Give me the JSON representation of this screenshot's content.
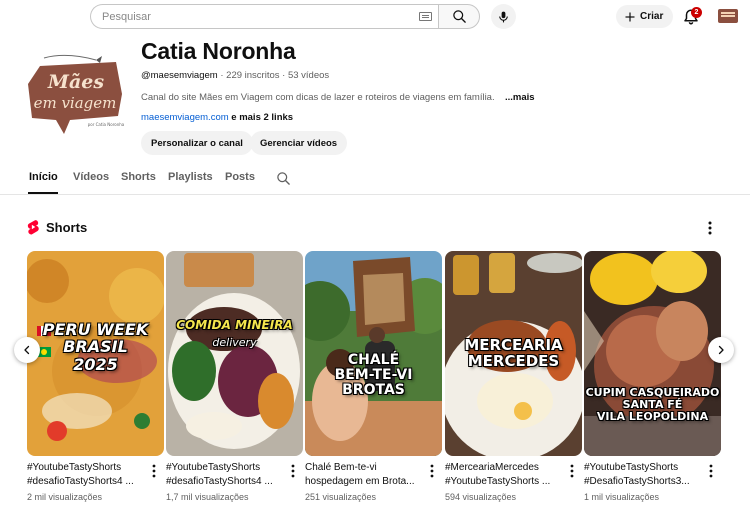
{
  "topbar": {
    "search": {
      "placeholder": "Pesquisar",
      "value": ""
    },
    "create_label": "Criar",
    "notifications_count": "2"
  },
  "channel": {
    "logo_line1": "Mães",
    "logo_line2": "em viagem",
    "logo_byline": "por Catia Noronha",
    "name": "Catia Noronha",
    "handle": "@maesemviagem",
    "subscribers": "229 inscritos",
    "videos": "53 vídeos",
    "separator": "·",
    "description": "Canal do site Mães em Viagem com dicas de lazer e roteiros de viagens em família.",
    "more_label": "...mais",
    "link_url": "maesemviagem.com",
    "link_extra": "e mais 2 links",
    "customize_label": "Personalizar o canal",
    "manage_label": "Gerenciar vídeos"
  },
  "tabs": [
    {
      "label": "Início",
      "active": true
    },
    {
      "label": "Vídeos"
    },
    {
      "label": "Shorts"
    },
    {
      "label": "Playlists"
    },
    {
      "label": "Posts"
    }
  ],
  "shorts_section": {
    "title": "Shorts",
    "items": [
      {
        "overlay": "PERU WEEK\nBRASIL\n2025",
        "title_line1": "#YoutubeTastyShorts",
        "title_line2": "#desafioTastyShorts4 ...",
        "views": "2 mil visualizações"
      },
      {
        "overlay": "COMIDA MINEIRA",
        "overlay_sub": "delivery",
        "title_line1": "#YoutubeTastyShorts",
        "title_line2": "#desafioTastyShorts4 ...",
        "views": "1,7 mil visualizações"
      },
      {
        "overlay": "CHALÉ\nBEM-TE-VI\nBROTAS",
        "title_line1": "Chalé Bem-te-vi",
        "title_line2": "hospedagem em Brota...",
        "views": "251 visualizações"
      },
      {
        "overlay": "MERCEARIA\nMERCEDES",
        "title_line1": "#MerceariaMercedes",
        "title_line2": "#YoutubeTastyShorts ...",
        "views": "594 visualizações"
      },
      {
        "overlay": "CUPIM CASQUEIRADO\nSANTA FÉ\nVILA LEOPOLDINA",
        "title_line1": "#YoutubeTastyShorts",
        "title_line2": "#DesafioTastyShorts3...",
        "views": "1 mil visualizações"
      }
    ]
  },
  "colors": {
    "text": "#0f0f0f",
    "secondary_text": "#606060",
    "link": "#065fd4",
    "shorts_red": "#ff0033",
    "badge_red": "#cc0000",
    "logo_brown": "#8b4f3f"
  },
  "icons": [
    "search-icon",
    "keyboard-icon",
    "mic-icon",
    "plus-icon",
    "bell-icon",
    "shorts-icon",
    "more-vert-icon",
    "chevron-left-icon",
    "chevron-right-icon"
  ]
}
